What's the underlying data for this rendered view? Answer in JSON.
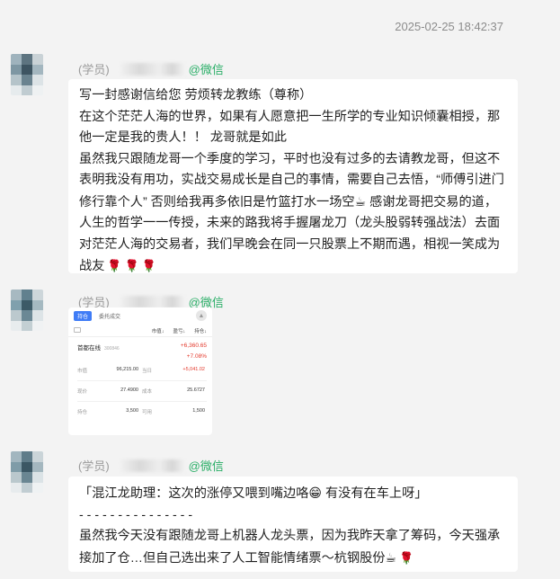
{
  "timestamp": "2025-02-25 18:42:37",
  "colors": {
    "background": "#f3f3f3",
    "bubble": "#ffffff",
    "wechat_green": "#2aae67",
    "rose": "#d2352d"
  },
  "messages": [
    {
      "role_tag": "(学员)",
      "source": "@微信",
      "lines": [
        "写一封感谢信给您 劳烦转龙教练（尊称）",
        "在这个茫茫人海的世界，如果有人愿意把一生所学的专业知识倾囊相授，那他一定是我的贵人！！ 龙哥就是如此",
        "虽然我只跟随龙哥一个季度的学习，平时也没有过多的去请教龙哥，但这不表明我没有用功，实战交易成长是自己的事情，需要自己去悟，“师傅引进门修行靠个人” 否则给我再多依旧是竹篮打水一场空",
        "感谢龙哥把交易的道，人生的哲学一一传授，未来的路我将手握屠龙刀（龙头股弱转强战法）去面对茫茫人海的交易者，我们早晚会在同一只股票上不期而遇，相视一笑成为战友"
      ],
      "emoji_coffee": "☕",
      "emoji_rose": "🌹"
    },
    {
      "role_tag": "(学员)",
      "source": "@微信",
      "card": {
        "tab_active": "持仓",
        "tab_other": "委托成交",
        "bell_icon": "bell-icon",
        "headers": [
          "市值↓",
          "盈亏↓",
          "持仓↓"
        ],
        "stock_name": "首都在线",
        "stock_code": "300846",
        "profit": "+6,360.65",
        "profit_pct": "+7.08%",
        "rows": [
          {
            "k1": "市值",
            "v1": "96,215.00",
            "k2": "当日",
            "v2": "+5,041.02"
          },
          {
            "k1": "现价",
            "v1": "27.4900",
            "k2": "成本",
            "v2": "25.6727"
          },
          {
            "k1": "持仓",
            "v1": "3,500",
            "k2": "可用",
            "v2": "1,500"
          }
        ]
      }
    },
    {
      "role_tag": "(学员)",
      "source": "@微信",
      "quote": "「混江龙助理：这次的涨停又喂到嘴边咯",
      "quote_tail": " 有没有在车上呀」",
      "emoji_grin": "😁",
      "divider": "- - - - - - - - - - - - - - -",
      "reply": "虽然我今天没有跟随龙哥上机器人龙头票，因为我昨天拿了筹码，今天强承接加了仓…但自己选出来了人工智能情绪票～杭钢股份",
      "emoji_coffee": "☕",
      "emoji_rose": "🌹"
    }
  ]
}
